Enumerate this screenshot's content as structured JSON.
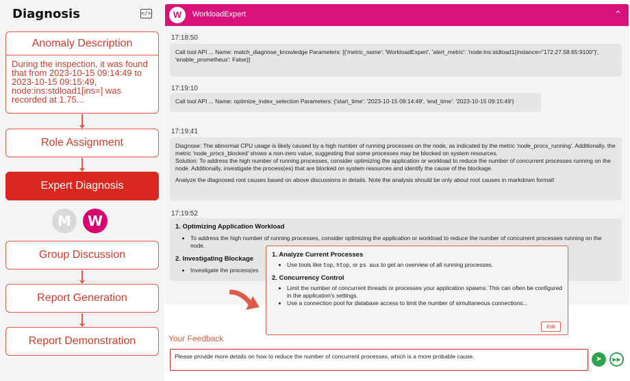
{
  "pipeline": {
    "title": "Diagnosis",
    "anomaly": {
      "title": "Anomaly Description",
      "text": "During the inspection, it was found that from 2023-10-15 09:14:49 to 2023-10-15 09:15:49, node:ins:stdload1[ins=] was recorded at 1.75..."
    },
    "role_assignment": "Role Assignment",
    "expert_diagnosis": "Expert Diagnosis",
    "avatars": [
      "M",
      "W"
    ],
    "group_discussion": "Group Discussion",
    "report_generation": "Report Generation",
    "report_demonstration": "Report Demonstration"
  },
  "chat": {
    "header": {
      "avatar": "W",
      "name": "WorkloadExpert"
    },
    "messages": [
      {
        "time": "17:18:50",
        "text": "Call tool API ... Name: match_diagnose_knowledge Parameters: [{'metric_name': 'WorkloadExpert', 'alert_metric': 'node:ins:stdload1{instance=\"172.27.58.65:9100\"}', 'enable_prometheus': False}]"
      },
      {
        "time": "17:19:10",
        "text": "Call tool API ... Name: optimize_index_selection Parameters: {'start_time': '2023-10-15 09:14:49', 'end_time': '2023-10-15 09:15:49'}"
      },
      {
        "time": "17:19:41",
        "diagnose": "Diagnose: The abnormal CPU usage is likely caused by a high number of running processes on the node, as indicated by the metric 'node_procs_running'. Additionally, the metric 'node_procs_blocked' shows a non-zero value, suggesting that some processes may be blocked on system resources.",
        "solution": "Solution: To address the high number of running processes, consider optimizing the application or workload to reduce the number of concurrent processes running on the node. Additionally, investigate the process(es) that are blocked on system resources and identify the cause of the blockage.",
        "note": "Analyze the diagnosed root causes based on above discussions in details. Note the analysis should be only about root causes in markdown format!"
      },
      {
        "time": "17:19:52",
        "h1": "1. Optimizing Application Workload",
        "b1": "To address the high number of running processes, consider optimizing the application or workload to reduce the number of concurrent processes running on the node.",
        "h2": "2. Investigating Blockage",
        "b2": "Investigate the process(es"
      }
    ],
    "popup": {
      "h1": "1. Analyze Current Processes",
      "b1_pre": "Use tools like ",
      "b1_code1": "top",
      "b1_sep1": ", ",
      "b1_code2": "htop",
      "b1_sep2": ", or ",
      "b1_code3": "ps aux",
      "b1_post": " to get an overview of all running processes.",
      "h2": "2. Concurrency Control",
      "b2": "Limit the number of concurrent threads or processes your application spawns. This can often be configured in the application's settings.",
      "b3": "Use a connection pool for database access to limit the number of simultaneous connections...",
      "edit": "Edit"
    },
    "feedback": {
      "label": "Your Feedback",
      "value": "Please provide more details on how to reduce the number of concurrent processes, which is a more probable cause."
    }
  },
  "icons": {
    "code": "code-icon",
    "collapse": "chevron-up-icon",
    "send": "send-icon",
    "skip": "fast-forward-icon",
    "arrow": "curved-arrow-icon"
  },
  "colors": {
    "accent": "#d9281f",
    "header": "#d9127a",
    "send": "#2ea44f"
  }
}
